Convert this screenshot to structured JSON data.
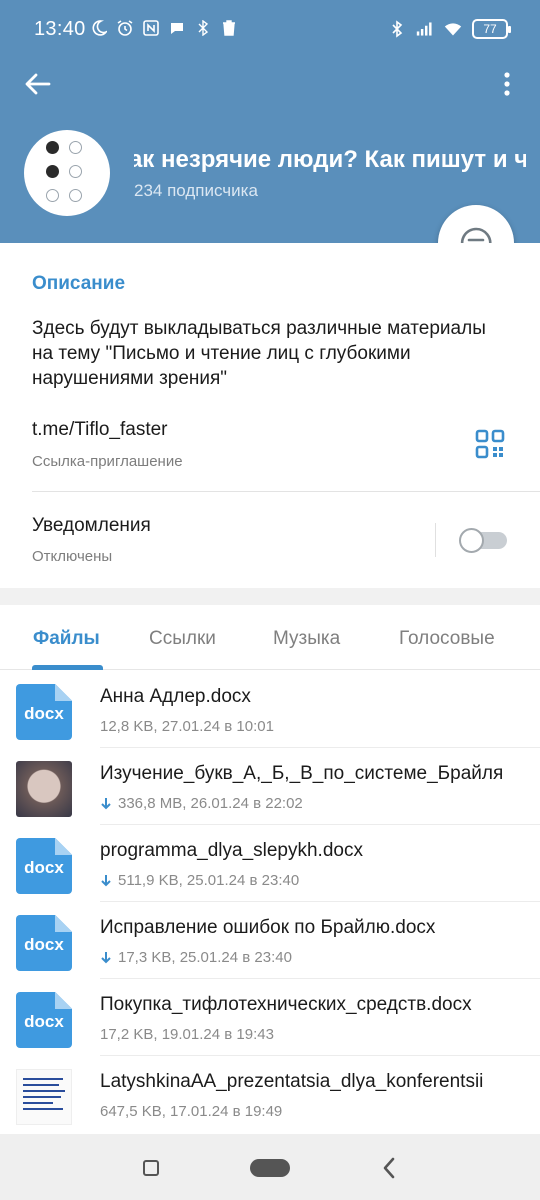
{
  "status_bar": {
    "time": "13:40",
    "battery": "77"
  },
  "header": {
    "title": "Как незрячие люди?   Как пишут и ч",
    "subscribers": "234 подписчика",
    "colors": {
      "header_bg": "#5a8fbb",
      "accent": "#3a8dcc"
    }
  },
  "info": {
    "description_label": "Описание",
    "description_text": "Здесь будут выкладываться различные материалы на тему \"Письмо и чтение лиц с глубокими нарушениями зрения\"",
    "link": "t.me/Tiflo_faster",
    "link_caption": "Ссылка-приглашение",
    "notifications_label": "Уведомления",
    "notifications_state": "Отключены",
    "notifications_on": false
  },
  "tabs": [
    {
      "label": "Файлы",
      "active": true
    },
    {
      "label": "Ссылки",
      "active": false
    },
    {
      "label": "Музыка",
      "active": false
    },
    {
      "label": "Голосовые",
      "active": false
    }
  ],
  "files": [
    {
      "name": "Анна Адлер.docx",
      "meta": "12,8 KB, 27.01.24 в 10:01",
      "thumb": "docx",
      "thumb_label": "docx",
      "downloaded": true
    },
    {
      "name": "Изучение_букв_А,_Б,_В_по_системе_Брайля",
      "meta": "336,8 MB, 26.01.24 в 22:02",
      "thumb": "photo",
      "downloaded": false
    },
    {
      "name": "programma_dlya_slepykh.docx",
      "meta": "511,9 KB, 25.01.24 в 23:40",
      "thumb": "docx",
      "thumb_label": "docx",
      "downloaded": false
    },
    {
      "name": "Исправление ошибок по Брайлю.docx",
      "meta": "17,3 KB, 25.01.24 в 23:40",
      "thumb": "docx",
      "thumb_label": "docx",
      "downloaded": false
    },
    {
      "name": "Покупка_тифлотехнических_средств.docx",
      "meta": "17,2 KB, 19.01.24 в 19:43",
      "thumb": "docx",
      "thumb_label": "docx",
      "downloaded": true
    },
    {
      "name": "LatyshkinaAA_prezentatsia_dlya_konferentsii",
      "meta": "647,5 KB, 17.01.24 в 19:49",
      "thumb": "document",
      "downloaded": true
    }
  ]
}
